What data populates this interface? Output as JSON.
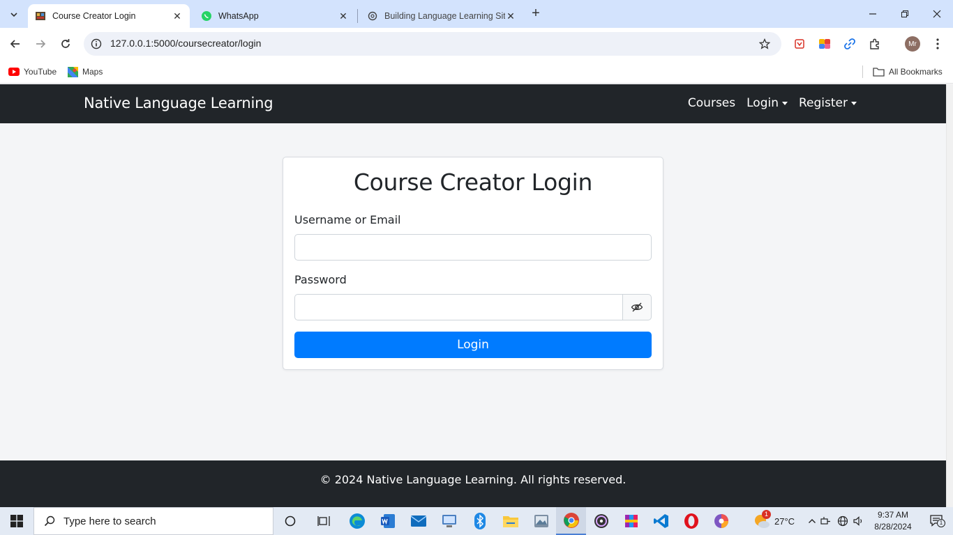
{
  "browser": {
    "tabs": [
      {
        "title": "Course Creator Login",
        "active": true
      },
      {
        "title": "WhatsApp",
        "active": false
      },
      {
        "title": "Building Language Learning Site",
        "active": false
      }
    ],
    "url": "127.0.0.1:5000/coursecreator/login",
    "bookmarks": [
      {
        "label": "YouTube"
      },
      {
        "label": "Maps"
      }
    ],
    "all_bookmarks_label": "All Bookmarks",
    "profile_initials": "Mr"
  },
  "site": {
    "brand": "Native Language Learning",
    "nav": {
      "courses": "Courses",
      "login": "Login",
      "register": "Register"
    },
    "form": {
      "title": "Course Creator Login",
      "username_label": "Username or Email",
      "username_value": "",
      "password_label": "Password",
      "password_value": "",
      "submit_label": "Login"
    },
    "footer": "© 2024 Native Language Learning. All rights reserved."
  },
  "taskbar": {
    "search_placeholder": "Type here to search",
    "weather": "27°C",
    "weather_badge": "1",
    "time": "9:37 AM",
    "date": "8/28/2024",
    "notification_count": "1"
  },
  "colors": {
    "navbar": "#212529",
    "primary_button": "#007bff",
    "page_background": "#f4f5f7"
  }
}
